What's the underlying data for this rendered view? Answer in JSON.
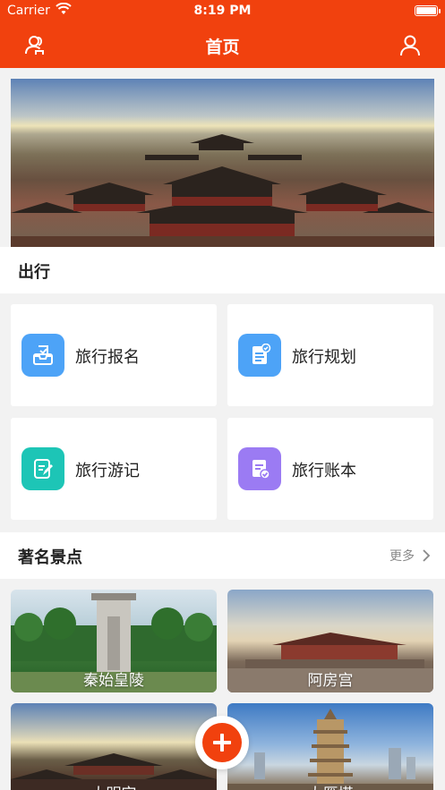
{
  "status_bar": {
    "carrier": "Carrier",
    "time": "8:19 PM"
  },
  "nav": {
    "title": "首页",
    "left_icon": "users-icon",
    "right_icon": "profile-icon"
  },
  "banner": {
    "alt": "palace-banner"
  },
  "travel": {
    "section_title": "出行",
    "items": [
      {
        "label": "旅行报名",
        "icon": "signup-inbox-icon",
        "color": "#4da3f7"
      },
      {
        "label": "旅行规划",
        "icon": "plan-document-icon",
        "color": "#4da3f7"
      },
      {
        "label": "旅行游记",
        "icon": "notes-edit-icon",
        "color": "#1dc5b6"
      },
      {
        "label": "旅行账本",
        "icon": "ledger-check-icon",
        "color": "#9b7bf3"
      }
    ]
  },
  "spots": {
    "section_title": "著名景点",
    "more_label": "更多",
    "items": [
      {
        "name": "秦始皇陵"
      },
      {
        "name": "阿房宫"
      },
      {
        "name": "大明宫"
      },
      {
        "name": "大雁塔"
      }
    ]
  },
  "colors": {
    "brand": "#f1410e"
  },
  "fab": {
    "icon": "add-icon"
  }
}
